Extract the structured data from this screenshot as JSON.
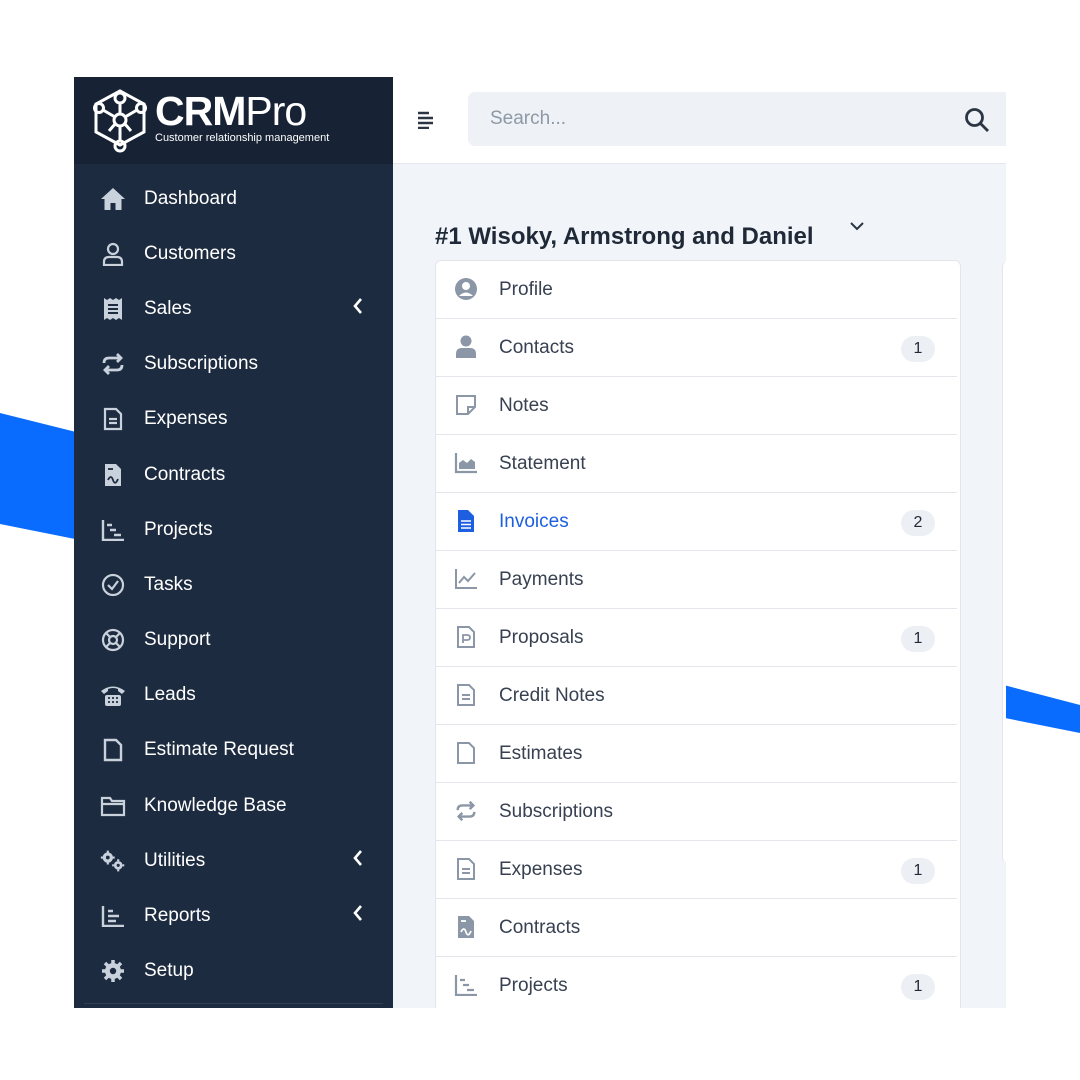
{
  "brand": {
    "name_bold": "CRM",
    "name_light": "Pro",
    "tagline": "Customer relationship management"
  },
  "sidebar": {
    "items": [
      {
        "label": "Dashboard",
        "icon": "home-icon",
        "submenu": false
      },
      {
        "label": "Customers",
        "icon": "user-icon",
        "submenu": false
      },
      {
        "label": "Sales",
        "icon": "receipt-icon",
        "submenu": true
      },
      {
        "label": "Subscriptions",
        "icon": "repeat-icon",
        "submenu": false
      },
      {
        "label": "Expenses",
        "icon": "file-text-icon",
        "submenu": false
      },
      {
        "label": "Contracts",
        "icon": "contract-icon",
        "submenu": false
      },
      {
        "label": "Projects",
        "icon": "gantt-chart-icon",
        "submenu": false
      },
      {
        "label": "Tasks",
        "icon": "check-circle-icon",
        "submenu": false
      },
      {
        "label": "Support",
        "icon": "life-ring-icon",
        "submenu": false
      },
      {
        "label": "Leads",
        "icon": "phone-icon",
        "submenu": false
      },
      {
        "label": "Estimate Request",
        "icon": "file-icon",
        "submenu": false
      },
      {
        "label": "Knowledge Base",
        "icon": "folder-icon",
        "submenu": false
      },
      {
        "label": "Utilities",
        "icon": "gears-icon",
        "submenu": true
      },
      {
        "label": "Reports",
        "icon": "bar-chart-icon",
        "submenu": true
      },
      {
        "label": "Setup",
        "icon": "gear-icon",
        "submenu": false
      }
    ]
  },
  "search": {
    "placeholder": "Search...",
    "value": ""
  },
  "customer": {
    "title": "#1 Wisoky, Armstrong and Daniel"
  },
  "tabs": [
    {
      "label": "Profile",
      "icon": "user-circle-icon",
      "badge": null,
      "active": false
    },
    {
      "label": "Contacts",
      "icon": "user-icon",
      "badge": "1",
      "active": false
    },
    {
      "label": "Notes",
      "icon": "sticky-note-icon",
      "badge": null,
      "active": false
    },
    {
      "label": "Statement",
      "icon": "area-chart-icon",
      "badge": null,
      "active": false
    },
    {
      "label": "Invoices",
      "icon": "file-text-icon",
      "badge": "2",
      "active": true
    },
    {
      "label": "Payments",
      "icon": "line-chart-icon",
      "badge": null,
      "active": false
    },
    {
      "label": "Proposals",
      "icon": "file-p-icon",
      "badge": "1",
      "active": false
    },
    {
      "label": "Credit Notes",
      "icon": "file-lines-icon",
      "badge": null,
      "active": false
    },
    {
      "label": "Estimates",
      "icon": "file-icon",
      "badge": null,
      "active": false
    },
    {
      "label": "Subscriptions",
      "icon": "repeat-icon",
      "badge": null,
      "active": false
    },
    {
      "label": "Expenses",
      "icon": "file-lines-icon",
      "badge": "1",
      "active": false
    },
    {
      "label": "Contracts",
      "icon": "contract-icon",
      "badge": null,
      "active": false
    },
    {
      "label": "Projects",
      "icon": "gantt-chart-icon",
      "badge": "1",
      "active": false
    }
  ],
  "colors": {
    "sidebar_bg": "#1c2b3f",
    "brand_bg": "#172335",
    "accent": "#1d5fe0",
    "decoration_blue": "#0a6cff"
  }
}
